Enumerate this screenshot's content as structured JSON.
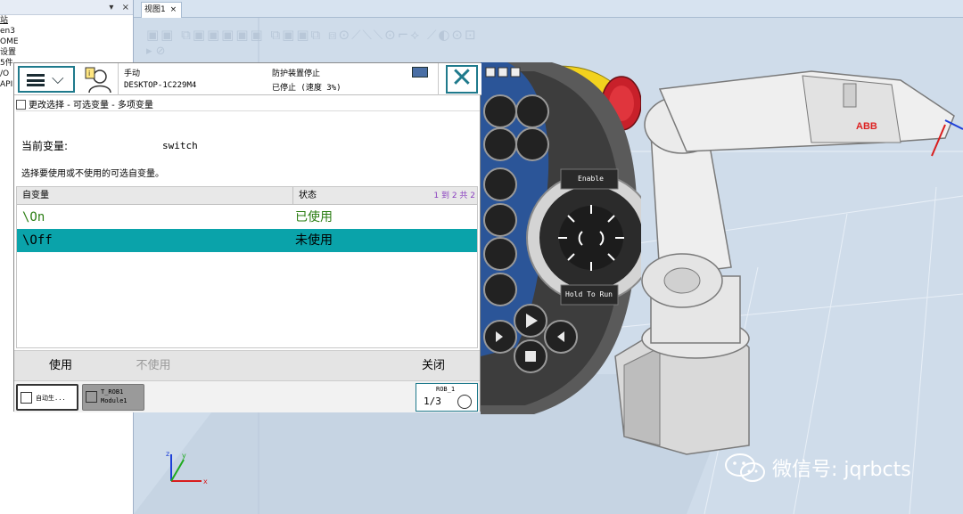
{
  "left_panel": {
    "collapse_glyph": "▾",
    "close_glyph": "×",
    "items": [
      "站",
      "en3",
      "OME",
      "设置",
      "5件",
      "/O",
      "API"
    ]
  },
  "view": {
    "tab_label": "视图1",
    "tab_close": "×",
    "toolbar_glyphs": "▣▣ ⧉▣▣▣▣▣ ⧉▣▣⧉ ⧈⊙⟋⟍⟍⊙⌐⟡ ⟋◐⊙⊡",
    "toolbar2_glyphs": "▸ ⊘"
  },
  "pendant_dialog": {
    "header": {
      "mode": "手动",
      "host": "DESKTOP-1C229M4",
      "safety": "防护装置停止",
      "state": "已停止 (速度 3%)"
    },
    "close_glyph": "✕",
    "breadcrumb": "更改选择 - 可选变量 - 多项变量",
    "current_variable_label": "当前变量:",
    "current_variable_value": "switch",
    "instruction": "选择要使用或不使用的可选自变量。",
    "table": {
      "columns": [
        "自变量",
        "状态"
      ],
      "paging": "1 到 2 共 2",
      "rows": [
        {
          "name": "\\On",
          "state": "已使用",
          "selected": false
        },
        {
          "name": "\\Off",
          "state": "未使用",
          "selected": true
        }
      ]
    },
    "buttons": {
      "use": "使用",
      "not_use": "不使用",
      "close": "关闭"
    },
    "taskbar": {
      "task1": "自动生...",
      "task2_line1": "T_ROB1",
      "task2_line2": "Module1",
      "rob_label": "ROB_1",
      "rob_fraction": "1/3"
    }
  },
  "pendant_controls": {
    "enable_label": "Enable",
    "hold_label": "Hold To Run",
    "win_glyphs": "▣ ▬ ✕"
  },
  "scene": {
    "robot_brand": "ABB",
    "axis_x": "x",
    "axis_y": "y",
    "axis_z": "z"
  },
  "watermark": {
    "text": "微信号: jqrbcts"
  },
  "colors": {
    "teal_accent": "#1f7a8c",
    "selected_row": "#0aa3aa",
    "green_text": "#2a7d12",
    "pendant_blue": "#2b5598",
    "estop_red": "#c8202a",
    "estop_yellow": "#f2d21e",
    "view_bg": "#cfdcea"
  }
}
